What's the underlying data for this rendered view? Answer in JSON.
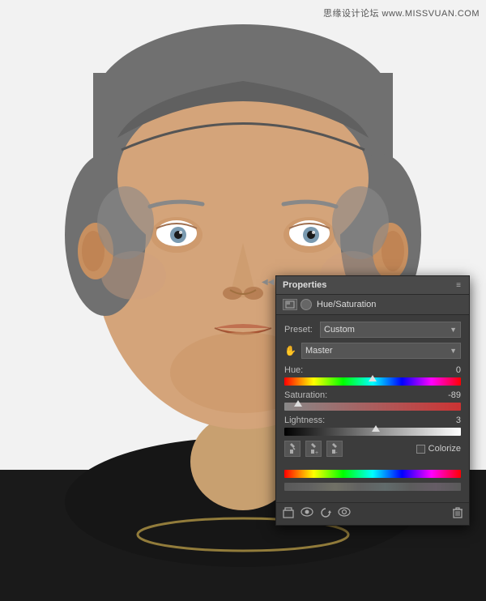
{
  "watermark": "思缘设计论坛 www.MISSVUAN.COM",
  "panel": {
    "title": "Properties",
    "layer_title": "Hue/Saturation",
    "preset_label": "Preset:",
    "preset_value": "Custom",
    "channel_value": "Master",
    "hue_label": "Hue:",
    "hue_value": "0",
    "hue_thumb_pct": 50,
    "saturation_label": "Saturation:",
    "saturation_value": "-89",
    "saturation_thumb_pct": 8,
    "lightness_label": "Lightness:",
    "lightness_value": "3",
    "lightness_thumb_pct": 52,
    "colorize_label": "Colorize",
    "collapse_symbol": "◀◀",
    "menu_symbol": "≡"
  }
}
